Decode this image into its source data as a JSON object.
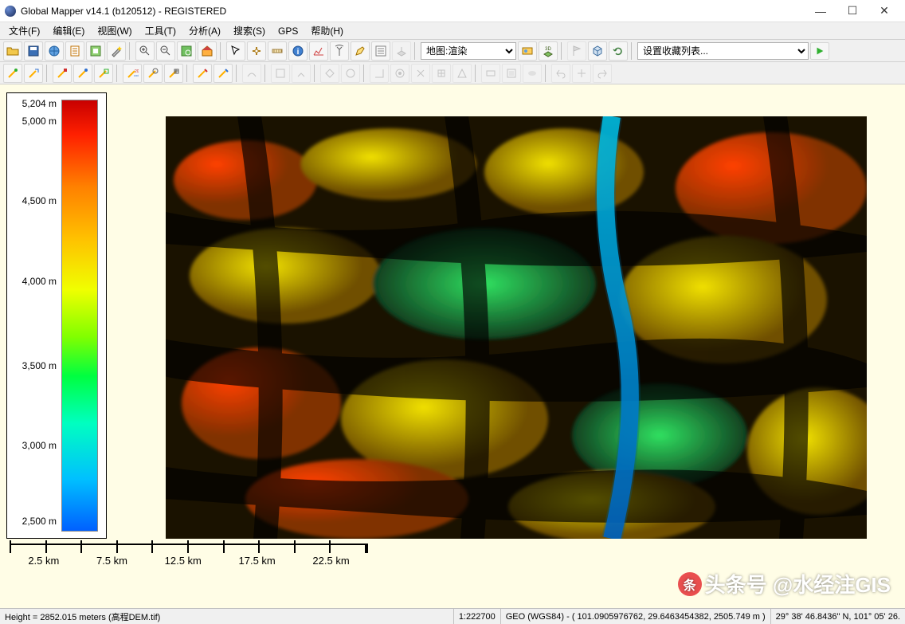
{
  "window": {
    "title": "Global Mapper v14.1 (b120512) - REGISTERED",
    "min": "—",
    "max": "☐",
    "close": "✕"
  },
  "menu": {
    "file": "文件(F)",
    "edit": "编辑(E)",
    "view": "视图(W)",
    "tools": "工具(T)",
    "analysis": "分析(A)",
    "search": "搜索(S)",
    "gps": "GPS",
    "help": "帮助(H)"
  },
  "combo": {
    "mapview": "地图:渲染",
    "favorites": "设置收藏列表..."
  },
  "legend": {
    "ticks": [
      {
        "label": "5,204 m",
        "pos": 1
      },
      {
        "label": "5,000 m",
        "pos": 5
      },
      {
        "label": "4,500 m",
        "pos": 23
      },
      {
        "label": "4,000 m",
        "pos": 41
      },
      {
        "label": "3,500 m",
        "pos": 60
      },
      {
        "label": "3,000 m",
        "pos": 78
      },
      {
        "label": "2,500 m",
        "pos": 95
      }
    ]
  },
  "scale": {
    "labels": [
      "2.5 km",
      "7.5 km",
      "12.5 km",
      "17.5 km",
      "22.5 km"
    ]
  },
  "watermark": "头条号 @水经注GIS",
  "status": {
    "height": "Height = 2852.015 meters (高程DEM.tif)",
    "scale": "1:222700",
    "proj": "GEO (WGS84) - ( 101.0905976762, 29.6463454382, 2505.749 m )",
    "coord": "29° 38' 46.8436\" N, 101° 05' 26."
  },
  "chart_data": {
    "type": "map-legend",
    "title": "Elevation color ramp",
    "unit": "m",
    "min": 2500,
    "max": 5204,
    "ticks": [
      2500,
      3000,
      3500,
      4000,
      4500,
      5000,
      5204
    ],
    "scalebar_km": [
      0,
      2.5,
      5,
      7.5,
      10,
      12.5,
      15,
      17.5,
      20,
      22.5,
      25
    ]
  }
}
